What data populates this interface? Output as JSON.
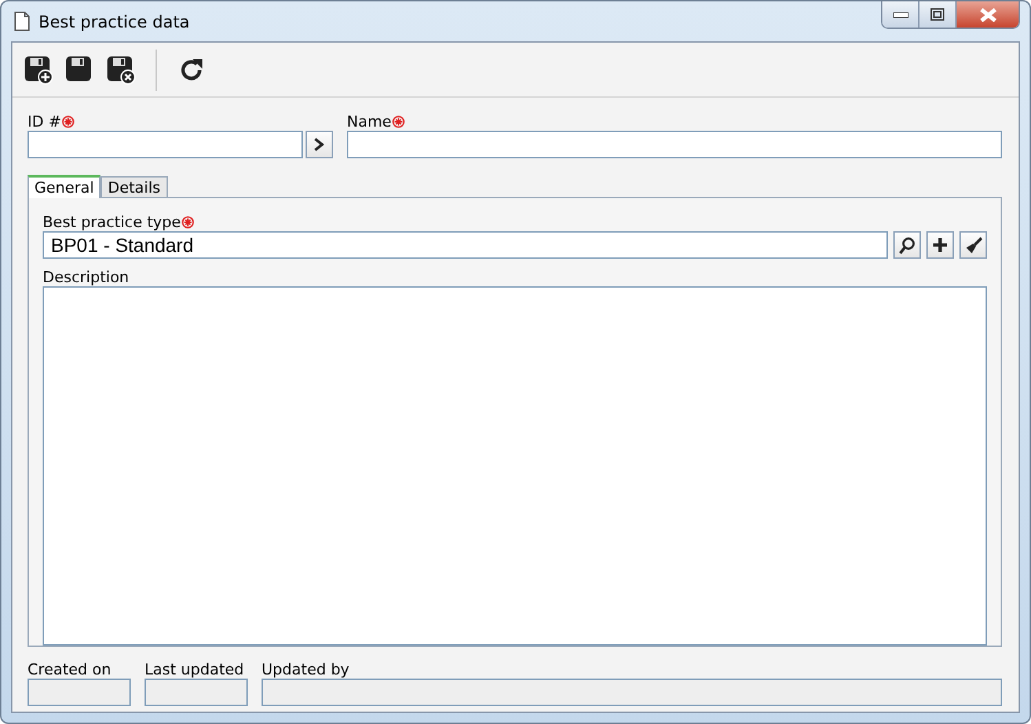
{
  "window": {
    "title": "Best practice data"
  },
  "id_field": {
    "label": "ID #",
    "required": true
  },
  "name_field": {
    "label": "Name",
    "required": true
  },
  "tabs": [
    {
      "label": "General",
      "selected": true
    },
    {
      "label": "Details",
      "selected": false
    }
  ],
  "type_field": {
    "label": "Best practice type",
    "required": true,
    "value": "BP01 - Standard"
  },
  "description": {
    "label": "Description"
  },
  "footer_fields": [
    {
      "label": "Created on",
      "disabled": true
    },
    {
      "label": "Last updated",
      "disabled": true
    },
    {
      "label": "Updated by",
      "disabled": true
    }
  ]
}
